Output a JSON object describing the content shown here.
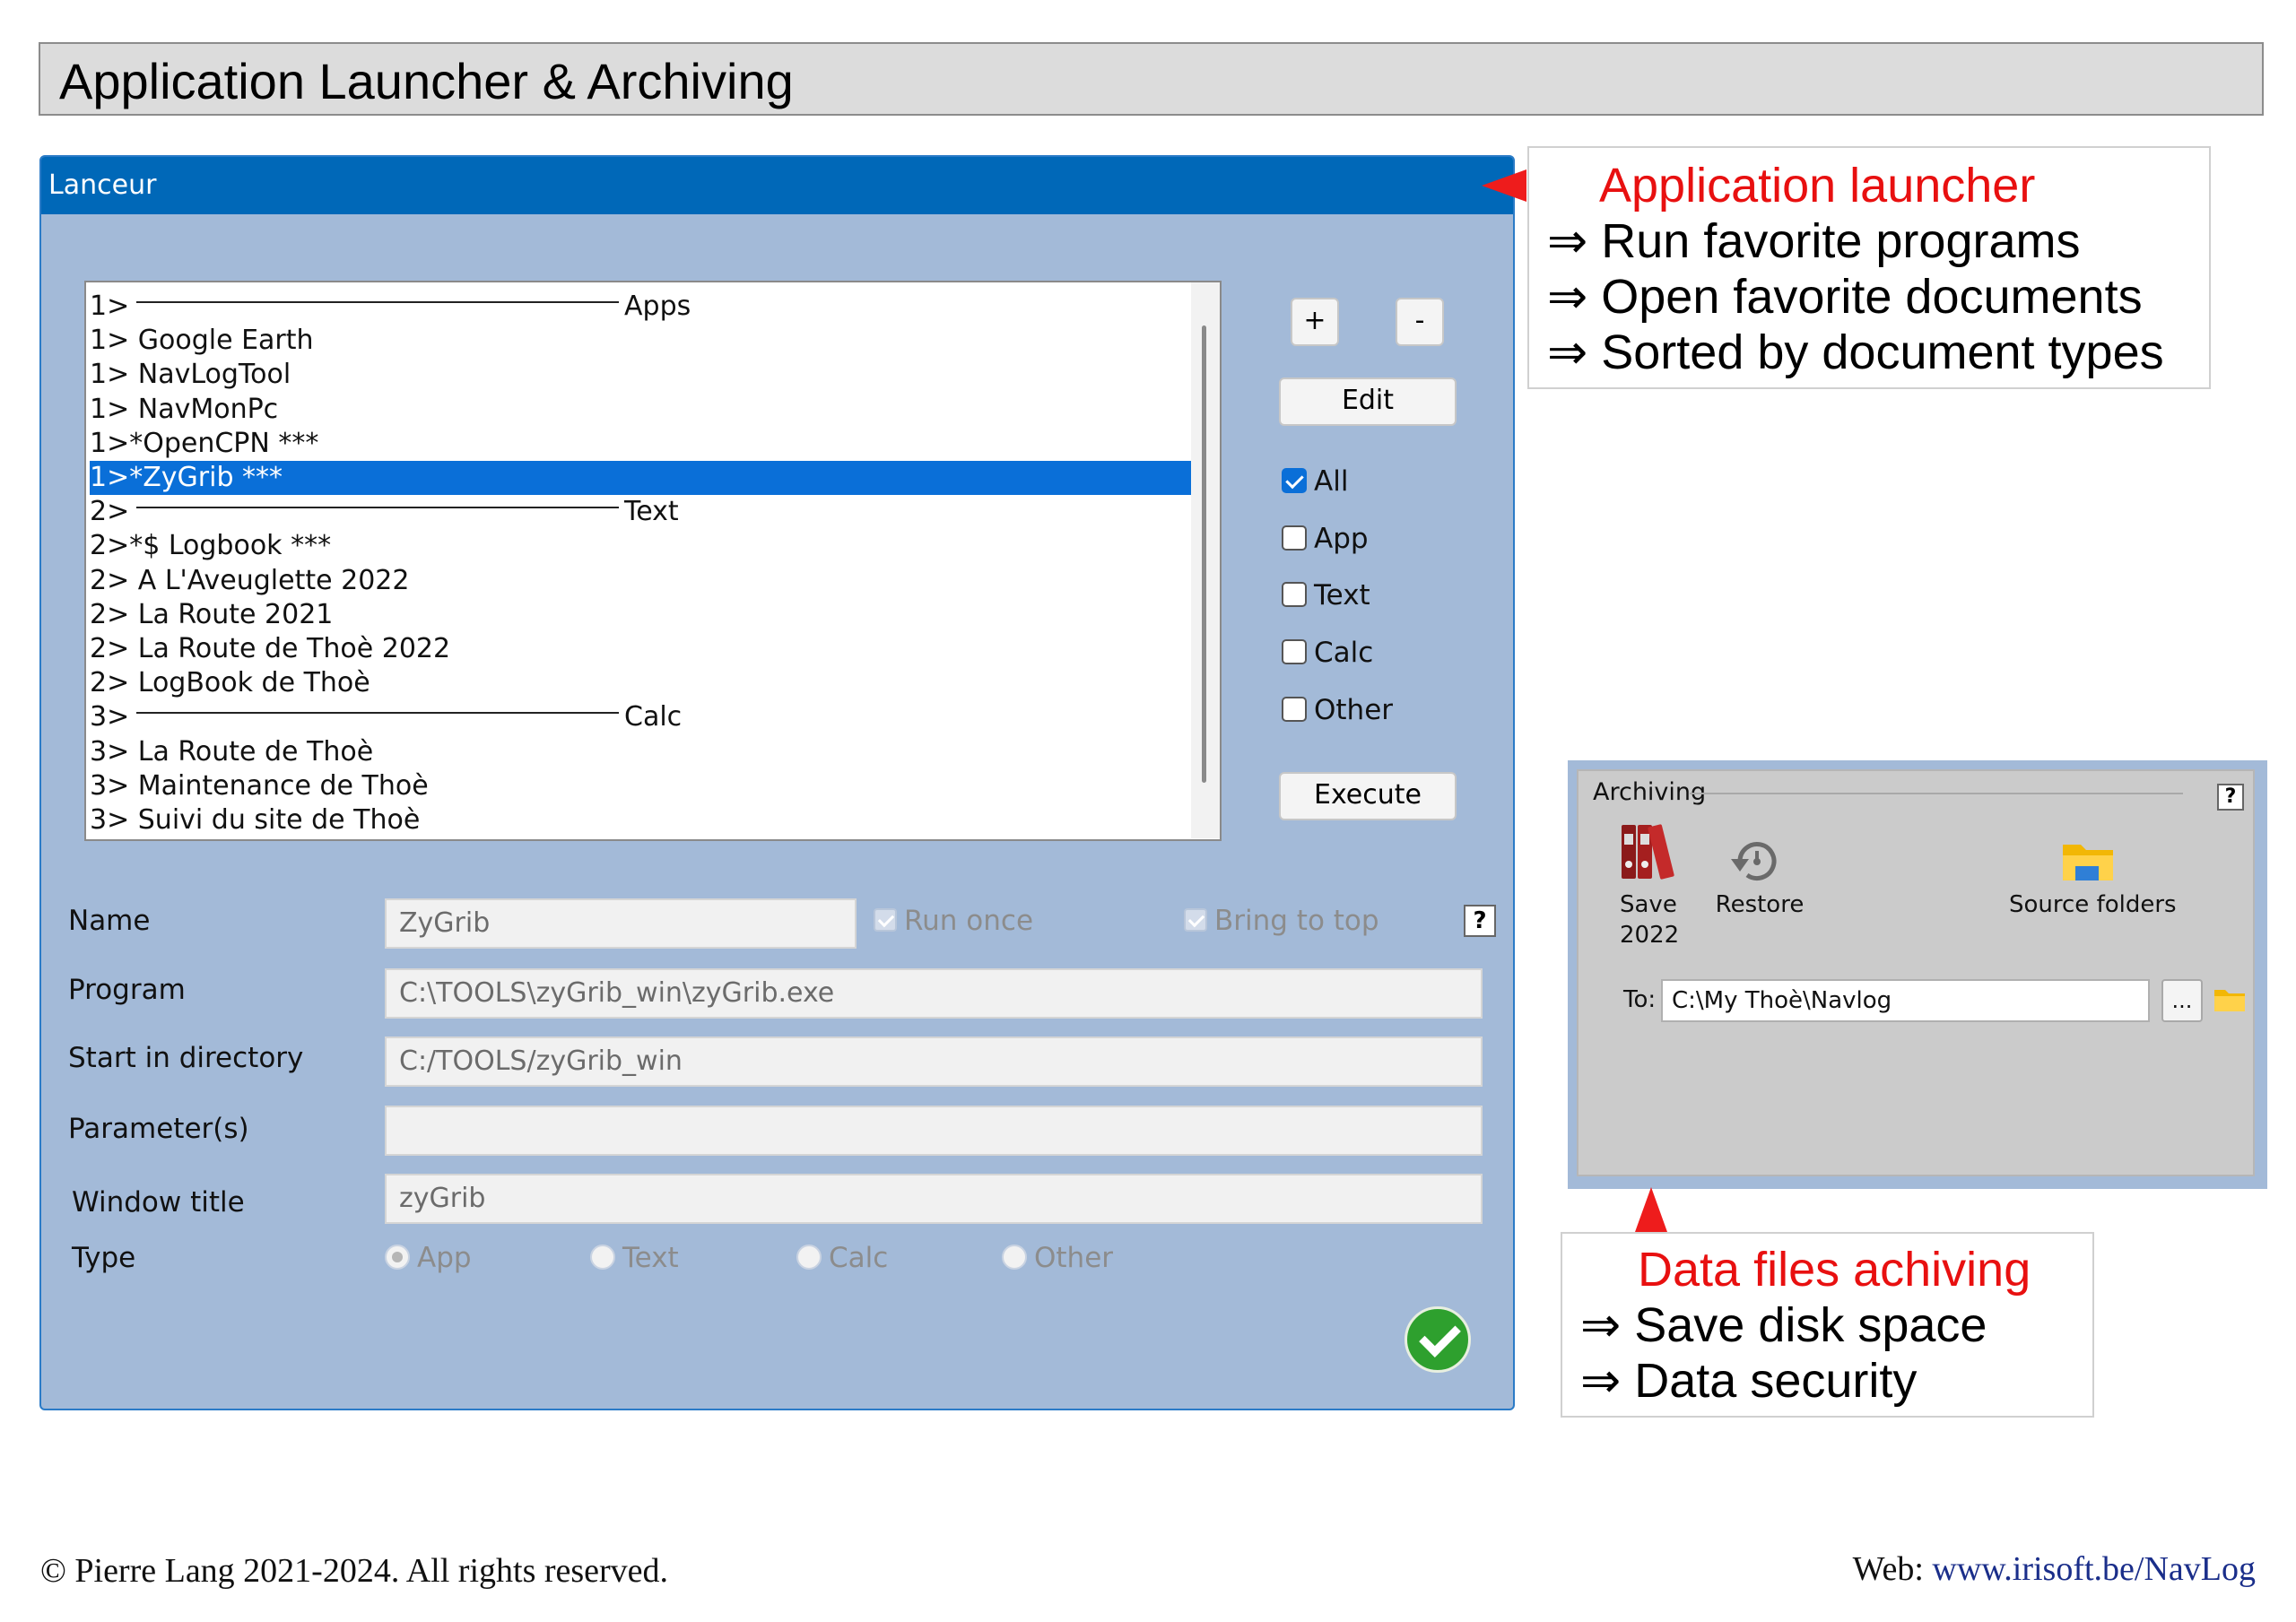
{
  "header": {
    "title": "Application Launcher & Archiving"
  },
  "launcher": {
    "window_title": "Lanceur",
    "list_items": [
      {
        "text": "1>",
        "group": "Apps",
        "separator": true
      },
      {
        "text": "1> Google Earth"
      },
      {
        "text": "1> NavLogTool"
      },
      {
        "text": "1> NavMonPc"
      },
      {
        "text": "1>*OpenCPN ***"
      },
      {
        "text": "1>*ZyGrib ***",
        "selected": true
      },
      {
        "text": "2>",
        "group": "Text",
        "separator": true
      },
      {
        "text": "2>*$ Logbook ***"
      },
      {
        "text": "2> A L'Aveuglette 2022"
      },
      {
        "text": "2> La Route 2021"
      },
      {
        "text": "2> La Route de Thoè 2022"
      },
      {
        "text": "2> LogBook de Thoè"
      },
      {
        "text": "3>",
        "group": "Calc",
        "separator": true
      },
      {
        "text": "3> La Route de Thoè"
      },
      {
        "text": "3> Maintenance de Thoè"
      },
      {
        "text": "3> Suivi du site de Thoè"
      }
    ],
    "buttons": {
      "add": "+",
      "remove": "-",
      "edit": "Edit",
      "execute": "Execute"
    },
    "filters": [
      {
        "label": "All",
        "checked": true
      },
      {
        "label": "App",
        "checked": false
      },
      {
        "label": "Text",
        "checked": false
      },
      {
        "label": "Calc",
        "checked": false
      },
      {
        "label": "Other",
        "checked": false
      }
    ],
    "form": {
      "name_label": "Name",
      "name_value": "ZyGrib",
      "run_once_label": "Run once",
      "bring_to_top_label": "Bring to top",
      "help_label": "?",
      "program_label": "Program",
      "program_value": "C:\\TOOLS\\zyGrib_win\\zyGrib.exe",
      "start_dir_label": "Start in directory",
      "start_dir_value": "C:/TOOLS/zyGrib_win",
      "params_label": "Parameter(s)",
      "params_value": "",
      "window_title_label": "Window title",
      "window_title_value": "zyGrib",
      "type_label": "Type",
      "type_options": [
        "App",
        "Text",
        "Calc",
        "Other"
      ],
      "type_selected": "App"
    }
  },
  "callout_launcher": {
    "title": "Application launcher",
    "lines": [
      "⇒ Run favorite programs",
      "⇒ Open favorite documents",
      "⇒ Sorted by document types"
    ]
  },
  "archiving": {
    "title": "Archiving",
    "help": "?",
    "save_label": "Save",
    "save_year": "2022",
    "restore_label": "Restore",
    "source_label": "Source folders",
    "to_label": "To:",
    "to_value": "C:\\My Thoè\\Navlog",
    "browse_label": "..."
  },
  "callout_archiving": {
    "title": "Data files achiving",
    "lines": [
      "⇒ Save disk space",
      "⇒ Data security"
    ]
  },
  "footer": {
    "copyright": "© Pierre Lang 2021-2024. All rights reserved.",
    "web_label": "Web: ",
    "web_link": "www.irisoft.be/NavLog"
  },
  "colors": {
    "accent": "#0068b8",
    "window_bg": "#a3bad8",
    "callout_title": "#e81010",
    "ok_green": "#2ea02e"
  }
}
